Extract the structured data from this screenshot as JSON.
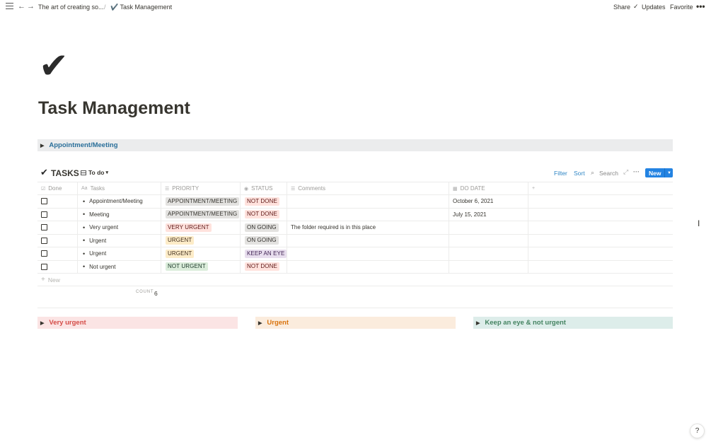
{
  "topbar": {
    "breadcrumb_parent": "The art of creating so...",
    "breadcrumb_separator": "/",
    "breadcrumb_current": "✔️ Task Management",
    "share_label": "Share",
    "updates_label": "Updates",
    "favorite_label": "Favorite"
  },
  "page": {
    "icon": "✔",
    "title": "Task Management"
  },
  "toggles": {
    "appointment": "Appointment/Meeting",
    "very_urgent": "Very urgent",
    "urgent": "Urgent",
    "keep_an_eye": "Keep an eye & not urgent"
  },
  "view": {
    "icon": "✔",
    "title": "TASKS",
    "tab_label": "To do",
    "filter_label": "Filter",
    "sort_label": "Sort",
    "search_label": "Search",
    "new_label": "New"
  },
  "table": {
    "headers": {
      "done": "Done",
      "tasks": "Tasks",
      "priority": "PRIORITY",
      "status": "STATUS",
      "comments": "Comments",
      "do_date": "DO DATE"
    },
    "rows": [
      {
        "task": "Appointment/Meeting",
        "priority": "APPOINTMENT/MEETING",
        "status": "NOT DONE",
        "comments": "",
        "do_date": "October 6, 2021"
      },
      {
        "task": "Meeting",
        "priority": "APPOINTMENT/MEETING",
        "status": "NOT DONE",
        "comments": "",
        "do_date": "July 15, 2021"
      },
      {
        "task": "Very urgent",
        "priority": "VERY URGENT",
        "status": "ON GOING",
        "comments": "The folder required is in this place",
        "do_date": ""
      },
      {
        "task": "Urgent",
        "priority": "URGENT",
        "status": "ON GOING",
        "comments": "",
        "do_date": ""
      },
      {
        "task": "Urgent",
        "priority": "URGENT",
        "status": "KEEP AN EYE",
        "comments": "",
        "do_date": ""
      },
      {
        "task": "Not urgent",
        "priority": "NOT URGENT",
        "status": "NOT DONE",
        "comments": "",
        "do_date": ""
      }
    ],
    "new_row_label": "New",
    "count_label": "COUNT",
    "count_value": "6"
  },
  "help_label": "?",
  "colors": {
    "accent_blue": "#2383e2",
    "link_blue": "#2f86c5",
    "very_urgent_bg": "#fbe4e4",
    "urgent_bg": "#fbecdd",
    "keep_bg": "#ddedea"
  }
}
